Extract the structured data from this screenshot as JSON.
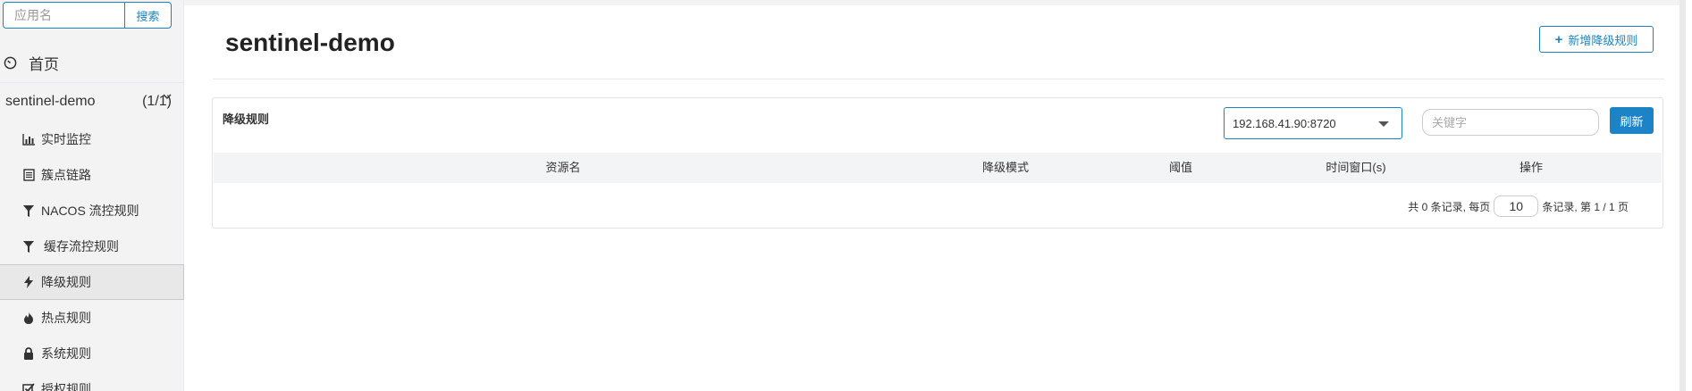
{
  "sidebar": {
    "search_placeholder": "应用名",
    "search_button": "搜索",
    "home_label": "首页",
    "app": {
      "name": "sentinel-demo",
      "count": "(1/1)"
    },
    "items": [
      {
        "label": "实时监控",
        "icon": "bar-chart-icon"
      },
      {
        "label": "簇点链路",
        "icon": "list-icon"
      },
      {
        "label": "NACOS 流控规则",
        "icon": "filter-icon"
      },
      {
        "label": "缓存流控规则",
        "icon": "filter-icon"
      },
      {
        "label": "降级规则",
        "icon": "bolt-icon",
        "active": true
      },
      {
        "label": "热点规则",
        "icon": "fire-icon"
      },
      {
        "label": "系统规则",
        "icon": "lock-icon"
      },
      {
        "label": "授权规则",
        "icon": "check-square-icon"
      }
    ]
  },
  "header": {
    "title": "sentinel-demo",
    "add_button": "新增降级规则"
  },
  "panel": {
    "title": "降级规则",
    "machine": "192.168.41.90:8720",
    "keyword_placeholder": "关键字",
    "refresh_button": "刷新",
    "columns": [
      "资源名",
      "降级模式",
      "阈值",
      "时间窗口(s)",
      "操作"
    ],
    "pager": {
      "prefix": "共 0 条记录, 每页",
      "page_size": "10",
      "suffix": "条记录, 第 1 / 1 页"
    }
  },
  "colors": {
    "accent": "#1c84c6",
    "sidebar_bg": "#f3f3f4",
    "header_row_bg": "#f3f4f5"
  }
}
